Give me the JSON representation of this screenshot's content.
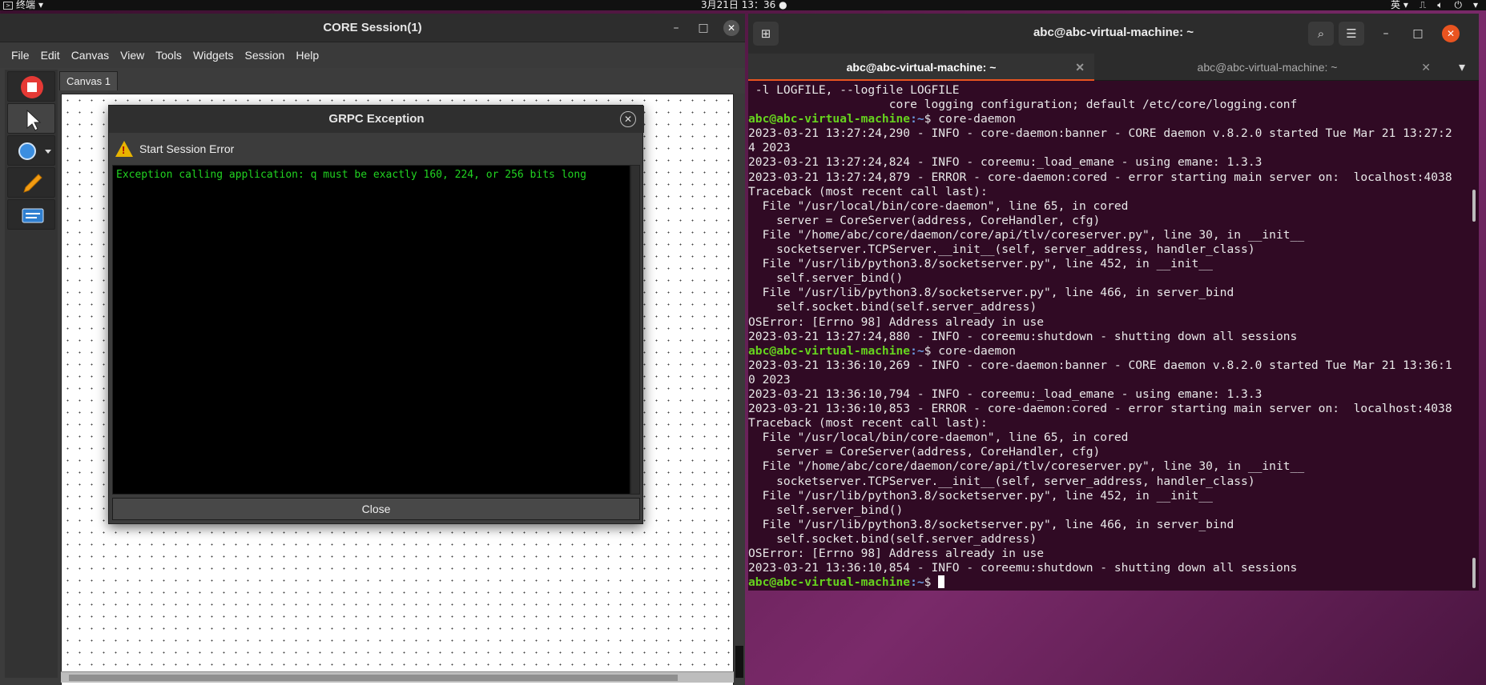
{
  "topbar": {
    "app_label": "终端",
    "clock": "3月21日  13：36",
    "input_method": "英"
  },
  "core": {
    "title": "CORE Session(1)",
    "menu": [
      "File",
      "Edit",
      "Canvas",
      "View",
      "Tools",
      "Widgets",
      "Session",
      "Help"
    ],
    "canvas_tab": "Canvas 1",
    "tools": [
      "stop-icon",
      "select-pointer-icon",
      "node-circle-icon",
      "pencil-annotate-icon",
      "run-tool-icon"
    ]
  },
  "dialog": {
    "title": "GRPC Exception",
    "header": "Start Session Error",
    "message": "Exception calling application: q must be exactly 160, 224, or 256 bits long",
    "close_label": "Close"
  },
  "terminal": {
    "title": "abc@abc-virtual-machine: ~",
    "tabs": [
      "abc@abc-virtual-machine: ~",
      "abc@abc-virtual-machine: ~"
    ],
    "prompt_user": "abc@abc-virtual-machine",
    "prompt_suffix": ":~$ ",
    "colors": {
      "background": "#300a24",
      "prompt": "#66d31e",
      "path": "#6b9be0"
    },
    "lines": [
      {
        "t": " -l LOGFILE, --logfile LOGFILE"
      },
      {
        "t": "                    core logging configuration; default /etc/core/logging.conf"
      },
      {
        "prompt": true,
        "t": "core-daemon"
      },
      {
        "t": "2023-03-21 13:27:24,290 - INFO - core-daemon:banner - CORE daemon v.8.2.0 started Tue Mar 21 13:27:2"
      },
      {
        "t": "4 2023"
      },
      {
        "t": "2023-03-21 13:27:24,824 - INFO - coreemu:_load_emane - using emane: 1.3.3"
      },
      {
        "t": "2023-03-21 13:27:24,879 - ERROR - core-daemon:cored - error starting main server on:  localhost:4038"
      },
      {
        "t": "Traceback (most recent call last):"
      },
      {
        "t": "  File \"/usr/local/bin/core-daemon\", line 65, in cored"
      },
      {
        "t": "    server = CoreServer(address, CoreHandler, cfg)"
      },
      {
        "t": "  File \"/home/abc/core/daemon/core/api/tlv/coreserver.py\", line 30, in __init__"
      },
      {
        "t": "    socketserver.TCPServer.__init__(self, server_address, handler_class)"
      },
      {
        "t": "  File \"/usr/lib/python3.8/socketserver.py\", line 452, in __init__"
      },
      {
        "t": "    self.server_bind()"
      },
      {
        "t": "  File \"/usr/lib/python3.8/socketserver.py\", line 466, in server_bind"
      },
      {
        "t": "    self.socket.bind(self.server_address)"
      },
      {
        "t": "OSError: [Errno 98] Address already in use"
      },
      {
        "t": "2023-03-21 13:27:24,880 - INFO - coreemu:shutdown - shutting down all sessions"
      },
      {
        "prompt": true,
        "t": "core-daemon"
      },
      {
        "t": "2023-03-21 13:36:10,269 - INFO - core-daemon:banner - CORE daemon v.8.2.0 started Tue Mar 21 13:36:1"
      },
      {
        "t": "0 2023"
      },
      {
        "t": "2023-03-21 13:36:10,794 - INFO - coreemu:_load_emane - using emane: 1.3.3"
      },
      {
        "t": "2023-03-21 13:36:10,853 - ERROR - core-daemon:cored - error starting main server on:  localhost:4038"
      },
      {
        "t": "Traceback (most recent call last):"
      },
      {
        "t": "  File \"/usr/local/bin/core-daemon\", line 65, in cored"
      },
      {
        "t": "    server = CoreServer(address, CoreHandler, cfg)"
      },
      {
        "t": "  File \"/home/abc/core/daemon/core/api/tlv/coreserver.py\", line 30, in __init__"
      },
      {
        "t": "    socketserver.TCPServer.__init__(self, server_address, handler_class)"
      },
      {
        "t": "  File \"/usr/lib/python3.8/socketserver.py\", line 452, in __init__"
      },
      {
        "t": "    self.server_bind()"
      },
      {
        "t": "  File \"/usr/lib/python3.8/socketserver.py\", line 466, in server_bind"
      },
      {
        "t": "    self.socket.bind(self.server_address)"
      },
      {
        "t": "OSError: [Errno 98] Address already in use"
      },
      {
        "t": "2023-03-21 13:36:10,854 - INFO - coreemu:shutdown - shutting down all sessions"
      },
      {
        "prompt": true,
        "t": "",
        "cursor": true
      }
    ]
  }
}
